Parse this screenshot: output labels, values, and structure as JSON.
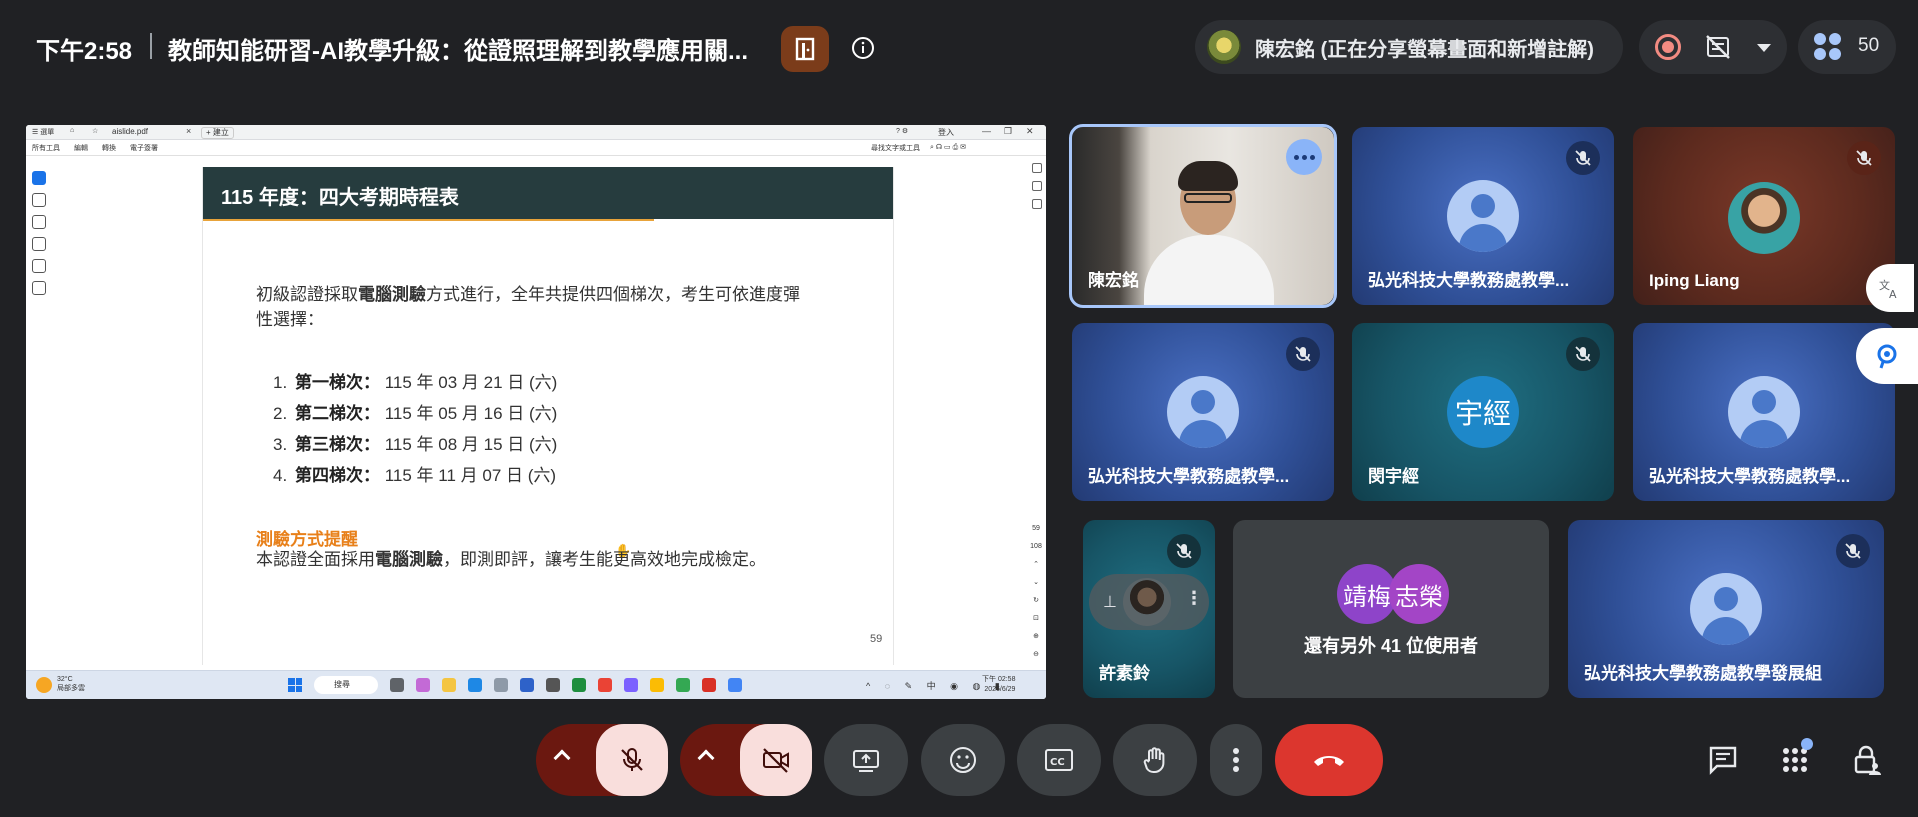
{
  "header": {
    "time": "下午2:58",
    "meeting_title": "教師知能研習-AI教學升級：從證照理解到教學應用關...",
    "presenter_status": "陳宏銘 (正在分享螢幕畫面和新增註解)",
    "participant_count": "50"
  },
  "shared_screen": {
    "tab_title": "aislide.pdf",
    "tab_new": "+ 建立",
    "login": "登入",
    "menu_items": [
      "所有工具",
      "編輯",
      "轉換",
      "電子簽署"
    ],
    "find_label": "尋找文字或工具",
    "slide": {
      "title": "115 年度：四大考期時程表",
      "intro_pre": "初級認證採取",
      "intro_bold": "電腦測驗",
      "intro_post": "方式進行，全年共提供四個梯次，考生可依進度彈性選擇：",
      "sessions": [
        {
          "num": "1.",
          "label": "第一梯次：",
          "date": "115 年 03 月 21 日 (六)"
        },
        {
          "num": "2.",
          "label": "第二梯次：",
          "date": "115 年 05 月 16 日 (六)"
        },
        {
          "num": "3.",
          "label": "第三梯次：",
          "date": "115 年 08 月 15 日 (六)"
        },
        {
          "num": "4.",
          "label": "第四梯次：",
          "date": "115 年 11 月 07 日 (六)"
        }
      ],
      "remind_title": "測驗方式提醒",
      "foot_pre": "本認證全面採用",
      "foot_bold": "電腦測驗",
      "foot_post": "，即測即評，讓考生能更高效地完成檢定。",
      "page_number": "59"
    },
    "pager_current": "59",
    "pager_total": "108",
    "taskbar": {
      "temperature": "32°C",
      "weather": "局部多雲",
      "search": "搜尋",
      "time": "下午 02:58",
      "date": "2026/6/29",
      "ime": "中"
    }
  },
  "tiles": [
    {
      "name": "陳宏銘",
      "kind": "video"
    },
    {
      "name": "弘光科技大學教務處教學...",
      "kind": "avatar",
      "muted": true
    },
    {
      "name": "Iping Liang",
      "kind": "photo",
      "muted": true
    },
    {
      "name": "弘光科技大學教務處教學...",
      "kind": "avatar",
      "muted": true
    },
    {
      "name": "閔宇經",
      "kind": "letters",
      "letters": "宇經",
      "muted": true
    },
    {
      "name": "弘光科技大學教務處教學...",
      "kind": "avatar",
      "muted": true
    },
    {
      "name": "許素鈴",
      "kind": "pip",
      "muted": true
    },
    {
      "name": "還有另外 41 位使用者",
      "kind": "others",
      "letters": [
        "靖梅",
        "志榮"
      ]
    },
    {
      "name": "弘光科技大學教務處教學發展組",
      "kind": "avatar",
      "muted": true
    }
  ],
  "controls": {
    "mic": "microphone-off",
    "camera": "camera-off",
    "present": "present-screen",
    "reactions": "emoji",
    "captions": "captions",
    "raise_hand": "raise-hand",
    "more": "more-options",
    "leave": "leave-call"
  },
  "colors": {
    "background": "#202124",
    "accent_blue": "#8ab4f8",
    "end_call": "#dc362e",
    "slide_header": "#263c3e",
    "remind_orange": "#e8801a"
  }
}
